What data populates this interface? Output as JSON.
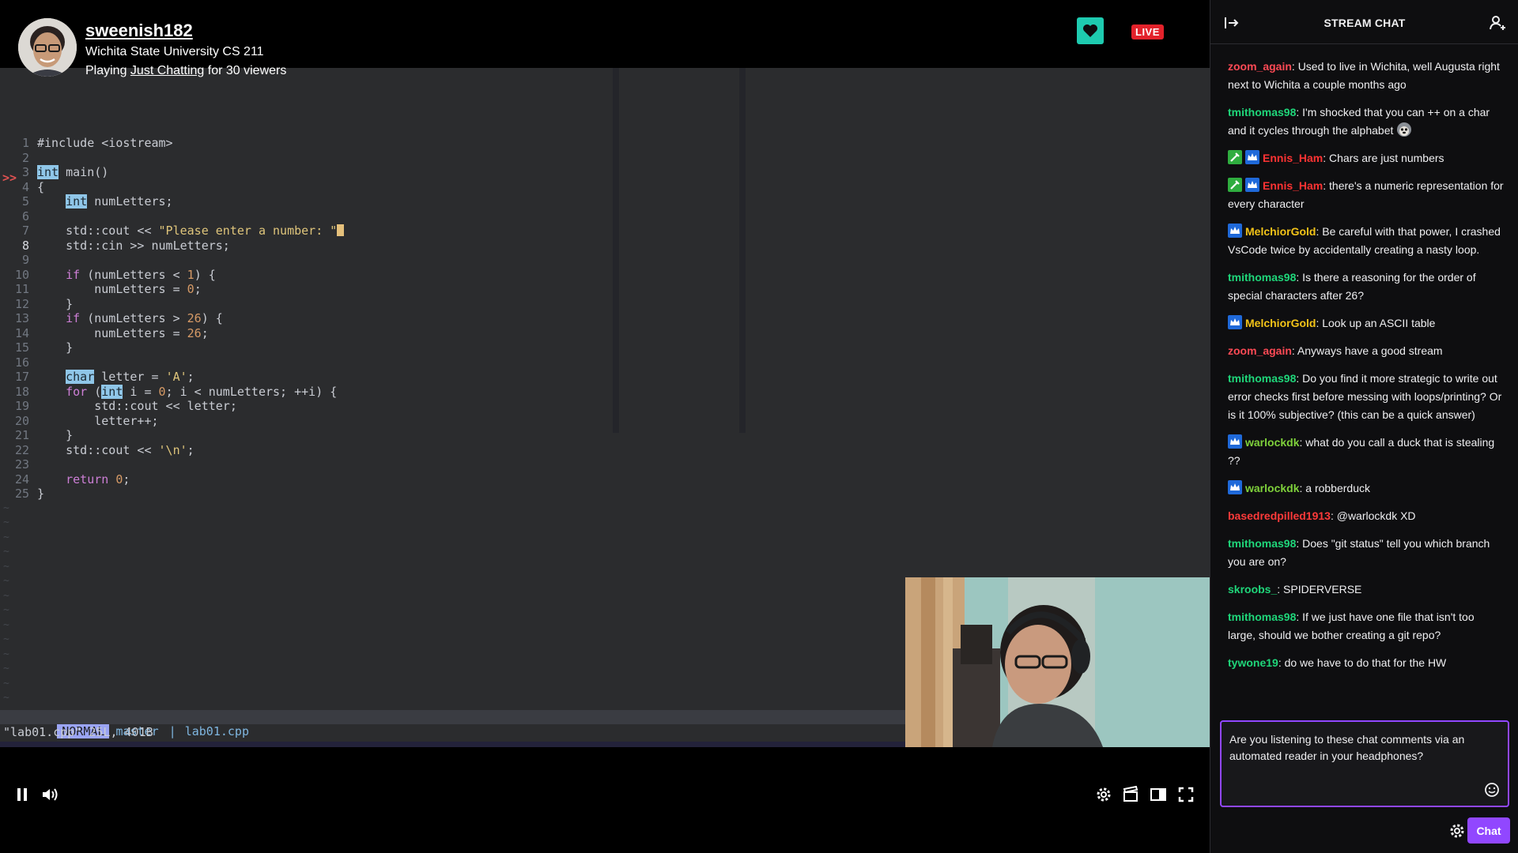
{
  "streamer": {
    "name": "sweenish182",
    "title": "Wichita State University CS 211",
    "playing_prefix": "Playing ",
    "game": "Just Chatting",
    "viewers_text": " for 30 viewers",
    "live_label": "LIVE"
  },
  "editor": {
    "lines": [
      {
        "n": "1",
        "text": "#include <iostream>"
      },
      {
        "n": "2",
        "text": ""
      },
      {
        "n": "3",
        "text": "int main()"
      },
      {
        "n": "4",
        "text": "{"
      },
      {
        "n": "5",
        "text": "    int numLetters;"
      },
      {
        "n": "6",
        "text": ""
      },
      {
        "n": "7",
        "text": "    std::cout << \"Please enter a number: \";"
      },
      {
        "n": "8",
        "text": "    std::cin >> numLetters;"
      },
      {
        "n": "9",
        "text": ""
      },
      {
        "n": "10",
        "text": "    if (numLetters < 1) {"
      },
      {
        "n": "11",
        "text": "        numLetters = 0;"
      },
      {
        "n": "12",
        "text": "    }"
      },
      {
        "n": "13",
        "text": "    if (numLetters > 26) {"
      },
      {
        "n": "14",
        "text": "        numLetters = 26;"
      },
      {
        "n": "15",
        "text": "    }"
      },
      {
        "n": "16",
        "text": ""
      },
      {
        "n": "17",
        "text": "    char letter = 'A';"
      },
      {
        "n": "18",
        "text": "    for (int i = 0; i < numLetters; ++i) {"
      },
      {
        "n": "19",
        "text": "        std::cout << letter;"
      },
      {
        "n": "20",
        "text": "        letter++;"
      },
      {
        "n": "21",
        "text": "    }"
      },
      {
        "n": "22",
        "text": "    std::cout << '\\n';"
      },
      {
        "n": "23",
        "text": ""
      },
      {
        "n": "24",
        "text": "    return 0;"
      },
      {
        "n": "25",
        "text": "}"
      }
    ],
    "breakpoint_marker": ">>",
    "mode": "NORMAL",
    "branch": "master",
    "separator": "|",
    "filename": "lab01.cpp",
    "cmdline": "\"lab01.cpp\" 25L, 401B"
  },
  "chat": {
    "header_title": "STREAM CHAT",
    "messages": [
      {
        "user": "zoom_again",
        "color": "#ff4a55",
        "badges": [],
        "text": "Used to live in Wichita, well Augusta right next to Wichita a couple months ago"
      },
      {
        "user": "tmithomas98",
        "color": "#1fd67a",
        "badges": [],
        "text": "I'm shocked that you can ++ on a char and it cycles through the alphabet",
        "emote": "monkey-emote"
      },
      {
        "user": "Ennis_Ham",
        "color": "#ff3333",
        "badges": [
          "mod",
          "sub"
        ],
        "text": "Chars are just numbers"
      },
      {
        "user": "Ennis_Ham",
        "color": "#ff3333",
        "badges": [
          "mod",
          "sub"
        ],
        "text": "there's a numeric representation for every character"
      },
      {
        "user": "MelchiorGold",
        "color": "#f2c318",
        "badges": [
          "sub"
        ],
        "text": "Be careful with that power, I crashed VsCode twice by accidentally creating a nasty loop."
      },
      {
        "user": "tmithomas98",
        "color": "#1fd67a",
        "badges": [],
        "text": "Is there a reasoning for the order of special characters after 26?"
      },
      {
        "user": "MelchiorGold",
        "color": "#f2c318",
        "badges": [
          "sub"
        ],
        "text": "Look up an ASCII table"
      },
      {
        "user": "zoom_again",
        "color": "#ff4a55",
        "badges": [],
        "text": "Anyways have a good stream"
      },
      {
        "user": "tmithomas98",
        "color": "#1fd67a",
        "badges": [],
        "text": "Do you find it more strategic to write out error checks first before messing with loops/printing? Or is it 100% subjective? (this can be a quick answer)"
      },
      {
        "user": "warlockdk",
        "color": "#7fd13b",
        "badges": [
          "sub"
        ],
        "text": "what do you call a duck that is stealing ??"
      },
      {
        "user": "warlockdk",
        "color": "#7fd13b",
        "badges": [
          "sub"
        ],
        "text": "a robberduck"
      },
      {
        "user": "basedredpilled1913",
        "color": "#ff3a3a",
        "badges": [],
        "text": "@warlockdk XD"
      },
      {
        "user": "tmithomas98",
        "color": "#1fd67a",
        "badges": [],
        "text": "Does \"git status\" tell you which branch you are on?"
      },
      {
        "user": "skroobs_",
        "color": "#1fd67a",
        "badges": [],
        "text": "SPIDERVERSE"
      },
      {
        "user": "tmithomas98",
        "color": "#1fd67a",
        "badges": [],
        "text": "If we just have one file that isn't too large, should we bother creating a git repo?"
      },
      {
        "user": "tywone19",
        "color": "#1fd67a",
        "badges": [],
        "text": "do we have to do that for the HW"
      }
    ],
    "input_value": "Are you listening to these chat comments via an automated reader in your headphones?",
    "send_label": "Chat"
  },
  "colors": {
    "accent": "#9147ff",
    "follow": "#1ecbb0",
    "live": "#e3222b"
  },
  "icons": [
    "heart-icon",
    "collapse-chat-icon",
    "community-icon",
    "pause-icon",
    "volume-icon",
    "settings-icon",
    "clip-icon",
    "theatre-mode-icon",
    "fullscreen-icon",
    "emote-picker-icon",
    "chat-settings-icon"
  ]
}
